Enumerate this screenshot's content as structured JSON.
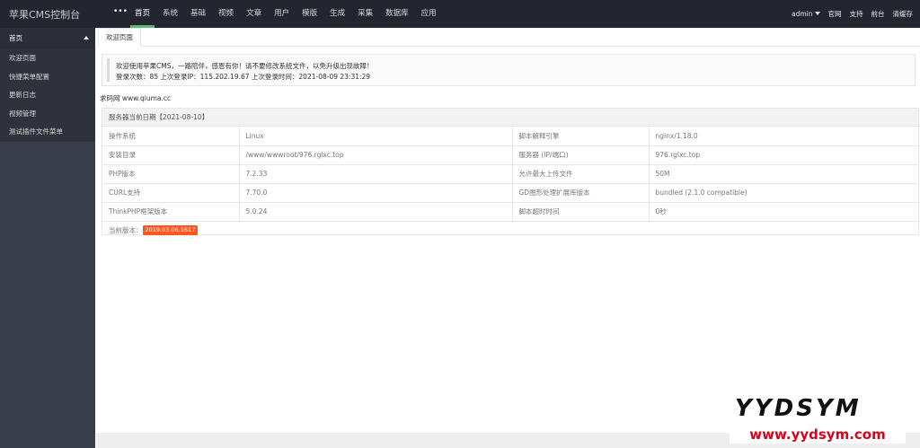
{
  "app": {
    "title": "苹果CMS控制台",
    "menu_toggle": "•••"
  },
  "topnav": [
    {
      "label": "首页",
      "active": true
    },
    {
      "label": "系统"
    },
    {
      "label": "基础"
    },
    {
      "label": "视频"
    },
    {
      "label": "文章"
    },
    {
      "label": "用户"
    },
    {
      "label": "模版"
    },
    {
      "label": "生成"
    },
    {
      "label": "采集"
    },
    {
      "label": "数据库"
    },
    {
      "label": "应用"
    }
  ],
  "right_menu": {
    "user": "admin",
    "official": "官网",
    "support": "支持",
    "frontend": "前台",
    "clear_cache": "清缓存"
  },
  "sidebar": {
    "header": "首页",
    "items": [
      {
        "label": "欢迎页面"
      },
      {
        "label": "快捷菜单配置"
      },
      {
        "label": "更新日志"
      },
      {
        "label": "视频管理"
      },
      {
        "label": "测试插件文件菜单"
      }
    ]
  },
  "tab": {
    "label": "欢迎页面"
  },
  "notice": {
    "line1": "欢迎使用苹果CMS，一路陪伴，感恩有你！请不要修改系统文件，以免升级出现故障！",
    "line2": "登录次数：85 上次登录IP：115.202.19.67 上次登录时间：2021-08-09 23:31:29"
  },
  "site_text": "求码网 www.qiuma.cc",
  "server": {
    "header": "服务器当前日期【2021-08-10】",
    "rows": [
      [
        "操作系统",
        "Linux",
        "脚本解释引擎",
        "nginx/1.18.0"
      ],
      [
        "安装目录",
        "/www/wwwroot/976.rglxc.top",
        "服务器 (IP/端口)",
        "976.rglxc.top"
      ],
      [
        "PHP版本",
        "7.2.33",
        "允许最大上传文件",
        "50M"
      ],
      [
        "CURL支持",
        "7.70.0",
        "GD图形处理扩展库版本",
        "bundled (2.1.0 compatible)"
      ],
      [
        "ThinkPHP框架版本",
        "5.0.24",
        "脚本超时时间",
        "0秒"
      ]
    ],
    "version_label": "当前版本：",
    "version": "2019.03.06.1617"
  },
  "watermark": {
    "brand": "YYDSYM",
    "url": "www.yydsym.com"
  },
  "colors": {
    "topbar": "#23262e",
    "sidebar": "#393d49",
    "active_underline": "#5FB878",
    "badge": "#FF5722"
  }
}
